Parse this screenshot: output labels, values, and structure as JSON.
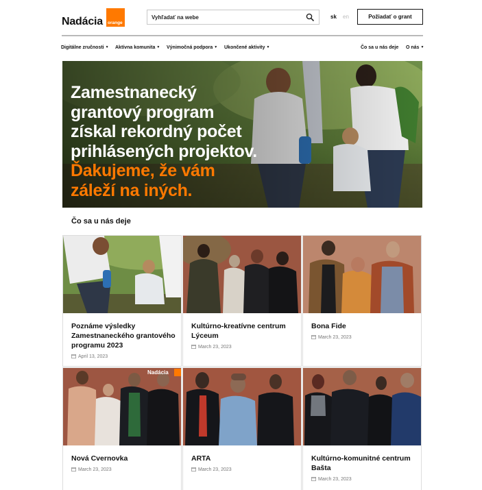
{
  "header": {
    "logo_word": "Nadácia",
    "logo_badge": "orange",
    "search_placeholder": "Vyhľadať na webe",
    "lang_active": "sk",
    "lang_inactive": "en",
    "grant_button": "Požiadať o grant"
  },
  "nav": {
    "left": [
      {
        "label": "Digitálne zručnosti"
      },
      {
        "label": "Aktívna komunita"
      },
      {
        "label": "Výnimočná podpora"
      },
      {
        "label": "Ukončené aktivity"
      }
    ],
    "right": [
      {
        "label": "Čo sa u nás deje"
      },
      {
        "label": "O nás"
      }
    ]
  },
  "hero": {
    "lines_white": [
      "Zamestnanecký",
      "grantový program",
      "získal rekordný počet",
      "prihlásených projektov."
    ],
    "lines_orange": [
      "Ďakujeme, že vám",
      "záleží na iných."
    ]
  },
  "section": {
    "title": "Čo sa u nás deje"
  },
  "cards": [
    {
      "title": "Poznáme výsledky Zamestnaneckého grantového programu 2023",
      "date": "April 13, 2023"
    },
    {
      "title": "Kultúrno-kreatívne centrum Lýceum",
      "date": "March 23, 2023"
    },
    {
      "title": "Bona Fide",
      "date": "March 23, 2023"
    },
    {
      "title": "Nová Cvernovka",
      "date": "March 23, 2023",
      "photo_watermark": "Nadácia"
    },
    {
      "title": "ARTA",
      "date": "March 23, 2023"
    },
    {
      "title": "Kultúrno-komunitné centrum Bašta",
      "date": "March 23, 2023"
    }
  ],
  "colors": {
    "brand_orange": "#ff7900",
    "text": "#111111",
    "muted": "#777777"
  }
}
